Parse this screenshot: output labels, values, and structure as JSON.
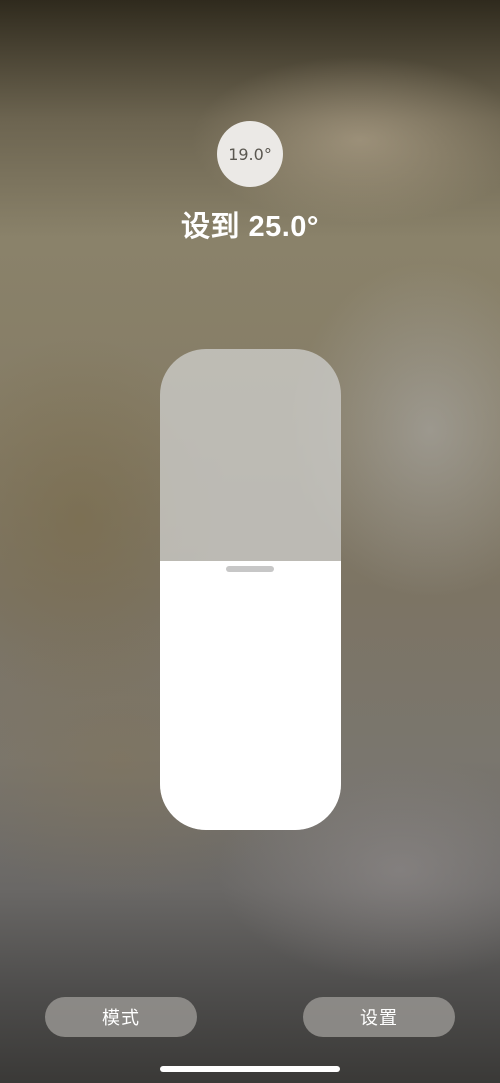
{
  "thermostat": {
    "current_temperature": "19.0°",
    "target_label": "设到 25.0°",
    "target_level_fraction": 0.56
  },
  "buttons": {
    "mode_label": "模式",
    "settings_label": "设置"
  },
  "colors": {
    "slider_fill": "#ffffff",
    "slider_track": "#cdcdcb",
    "button_bg": "#969491"
  }
}
